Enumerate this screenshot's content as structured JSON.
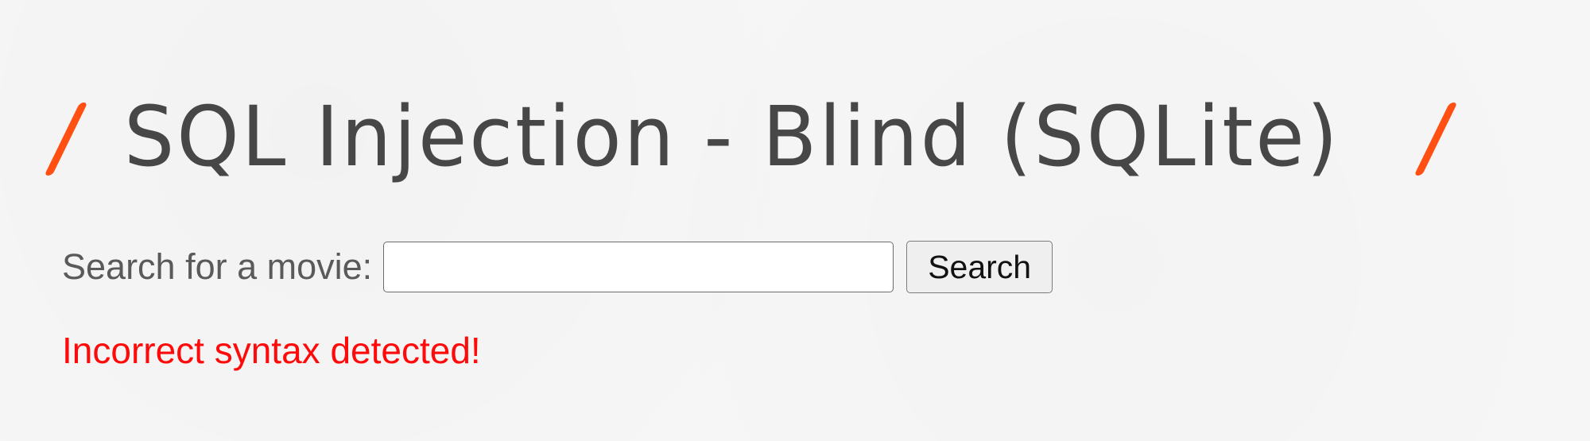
{
  "page": {
    "title": "SQL Injection - Blind (SQLite)",
    "accent_color": "#ff4f12"
  },
  "search": {
    "label": "Search for a movie:",
    "input_value": "",
    "placeholder": "",
    "button_label": "Search"
  },
  "status": {
    "error_message": "Incorrect syntax detected!",
    "error_color": "#ff0a0a"
  },
  "icons": {
    "decorative_slash": "slash-icon"
  }
}
